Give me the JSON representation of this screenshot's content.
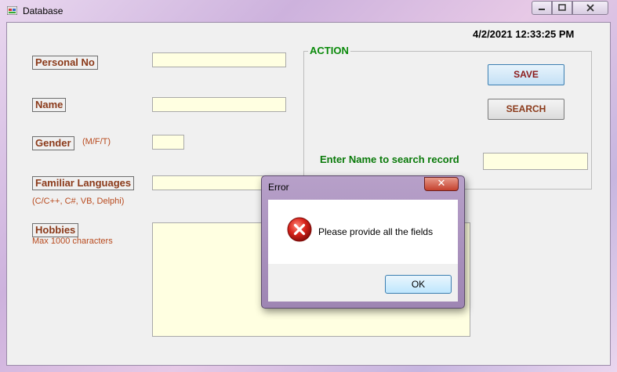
{
  "window": {
    "title": "Database"
  },
  "datetime": "4/2/2021 12:33:25 PM",
  "form": {
    "personal_no_label": "Personal No",
    "name_label": "Name",
    "gender_label": "Gender",
    "gender_hint": "(M/F/T)",
    "languages_label": "Familiar Languages",
    "languages_hint": "(C/C++, C#, VB, Delphi)",
    "hobbies_label": "Hobbies",
    "hobbies_hint": "Max 1000 characters"
  },
  "action": {
    "group_title": "ACTION",
    "save_label": "SAVE",
    "search_label": "SEARCH",
    "search_prompt": "Enter Name to search record"
  },
  "dialog": {
    "title": "Error",
    "close_glyph": "✕",
    "message": "Please provide all the fields",
    "ok_label": "OK"
  }
}
